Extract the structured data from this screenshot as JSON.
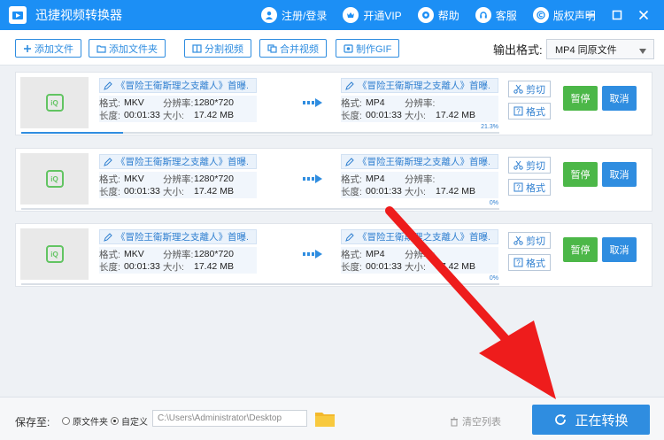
{
  "app": {
    "title": "迅捷视频转换器"
  },
  "titlebar": {
    "links": [
      {
        "label": "注册/登录",
        "icon": "user-icon"
      },
      {
        "label": "开通VIP",
        "icon": "vip-icon"
      },
      {
        "label": "帮助",
        "icon": "help-icon"
      },
      {
        "label": "客服",
        "icon": "headset-icon"
      },
      {
        "label": "版权声明",
        "icon": "copyright-icon"
      }
    ]
  },
  "toolbar": {
    "add_file": "添加文件",
    "add_folder": "添加文件夹",
    "split_video": "分割视频",
    "merge_video": "合并视频",
    "make_gif": "制作GIF",
    "format_label": "输出格式:",
    "format_value": "MP4  同原文件"
  },
  "labels": {
    "format": "格式:",
    "resolution": "分辨率:",
    "duration": "长度:",
    "size": "大小:",
    "cut": "剪切",
    "format_btn": "格式",
    "pause": "暂停",
    "cancel": "取消"
  },
  "rows": [
    {
      "source": {
        "name": "《冒险王衛斯理之支離人》首曝.",
        "format": "MKV",
        "resolution": "1280*720",
        "duration": "00:01:33",
        "size": "17.42 MB"
      },
      "target": {
        "name": "《冒险王衛斯理之支離人》首曝.",
        "format": "MP4",
        "resolution": "",
        "duration": "00:01:33",
        "size": "17.42 MB"
      },
      "progress_text": "21.3%",
      "progress": 0.213
    },
    {
      "source": {
        "name": "《冒险王衛斯理之支離人》首曝.",
        "format": "MKV",
        "resolution": "1280*720",
        "duration": "00:01:33",
        "size": "17.42 MB"
      },
      "target": {
        "name": "《冒险王衛斯理之支離人》首曝.",
        "format": "MP4",
        "resolution": "",
        "duration": "00:01:33",
        "size": "17.42 MB"
      },
      "progress_text": "0%",
      "progress": 0
    },
    {
      "source": {
        "name": "《冒险王衛斯理之支離人》首曝.",
        "format": "MKV",
        "resolution": "1280*720",
        "duration": "00:01:33",
        "size": "17.42 MB"
      },
      "target": {
        "name": "《冒险王衛斯理之支離人》首曝.",
        "format": "MP4",
        "resolution": "",
        "duration": "00:01:33",
        "size": "17.42 MB"
      },
      "progress_text": "0%",
      "progress": 0
    }
  ],
  "footer": {
    "save_to": "保存至:",
    "option_original": "原文件夹",
    "option_custom": "自定义",
    "path": "C:\\Users\\Administrator\\Desktop",
    "clear_list": "清空列表",
    "convert": "正在转换"
  },
  "colors": {
    "brand": "#1c8ff5",
    "accent": "#2f8de0",
    "pause": "#4cb748",
    "annotation": "#ee1c1c"
  }
}
